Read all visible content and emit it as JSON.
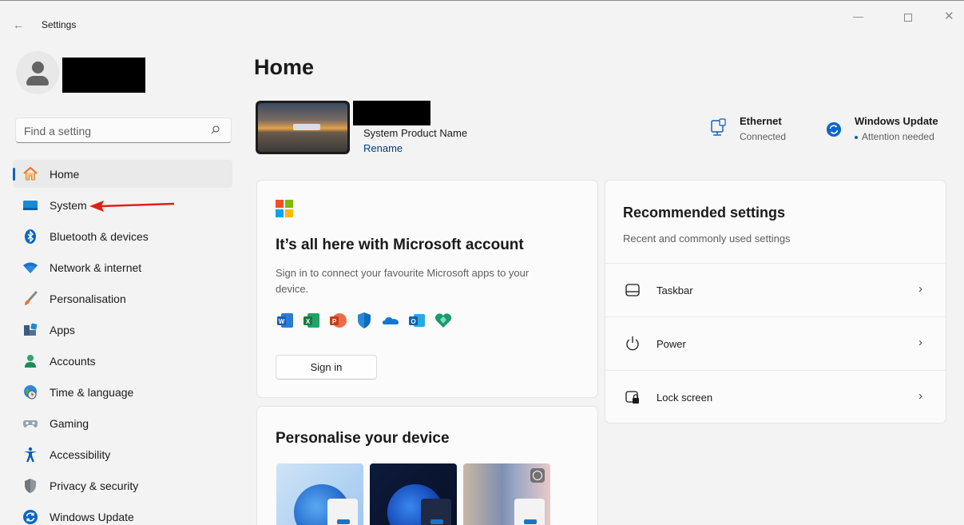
{
  "window": {
    "back_glyph": "←",
    "title": "Settings",
    "minimize_glyph": "—",
    "close_glyph": "✕"
  },
  "search": {
    "placeholder": "Find a setting"
  },
  "sidebar": {
    "items": [
      {
        "label": "Home",
        "icon": "home-icon",
        "active": true
      },
      {
        "label": "System",
        "icon": "system-icon"
      },
      {
        "label": "Bluetooth & devices",
        "icon": "bluetooth-icon"
      },
      {
        "label": "Network & internet",
        "icon": "wifi-icon"
      },
      {
        "label": "Personalisation",
        "icon": "brush-icon"
      },
      {
        "label": "Apps",
        "icon": "apps-icon"
      },
      {
        "label": "Accounts",
        "icon": "accounts-icon"
      },
      {
        "label": "Time & language",
        "icon": "globe-clock-icon"
      },
      {
        "label": "Gaming",
        "icon": "gamepad-icon"
      },
      {
        "label": "Accessibility",
        "icon": "accessibility-icon"
      },
      {
        "label": "Privacy & security",
        "icon": "shield-icon"
      },
      {
        "label": "Windows Update",
        "icon": "windows-update-icon"
      }
    ]
  },
  "main": {
    "title": "Home",
    "device": {
      "model": "System Product Name",
      "rename_label": "Rename"
    },
    "status": {
      "ethernet": {
        "title": "Ethernet",
        "subtitle": "Connected"
      },
      "windows_update": {
        "title": "Windows Update",
        "subtitle": "Attention needed"
      }
    },
    "microsoft_account": {
      "title": "It’s all here with Microsoft account",
      "description": "Sign in to connect your favourite Microsoft apps to your device.",
      "apps": [
        "word-icon",
        "excel-icon",
        "powerpoint-icon",
        "defender-icon",
        "onedrive-icon",
        "outlook-icon",
        "family-safety-icon"
      ],
      "sign_in_label": "Sign in"
    },
    "personalise": {
      "title": "Personalise your device",
      "themes": [
        "light-bloom-theme",
        "dark-bloom-theme",
        "spotlight-theme"
      ]
    },
    "recommended": {
      "title": "Recommended settings",
      "subtitle": "Recent and commonly used settings",
      "items": [
        {
          "label": "Taskbar",
          "icon": "taskbar-icon"
        },
        {
          "label": "Power",
          "icon": "power-icon"
        },
        {
          "label": "Lock screen",
          "icon": "lock-screen-icon"
        }
      ],
      "chevron": "›"
    }
  },
  "colors": {
    "accent": "#0067c0",
    "annotation_arrow": "#e0201a"
  }
}
